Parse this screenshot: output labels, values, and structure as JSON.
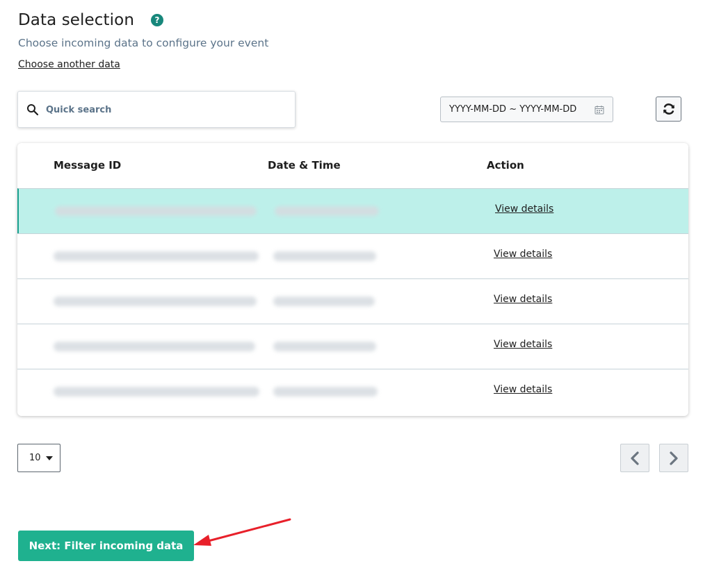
{
  "header": {
    "title": "Data selection",
    "help_glyph": "?",
    "subtitle": "Choose incoming data to configure your event",
    "choose_link": "Choose another data"
  },
  "search": {
    "placeholder": "Quick search",
    "value": ""
  },
  "date_range": {
    "value": "YYYY-MM-DD ~ YYYY-MM-DD"
  },
  "table": {
    "columns": [
      "Message ID",
      "Date & Time",
      "Action"
    ],
    "rows": [
      {
        "action": "View details",
        "selected": true
      },
      {
        "action": "View details",
        "selected": false
      },
      {
        "action": "View details",
        "selected": false
      },
      {
        "action": "View details",
        "selected": false
      },
      {
        "action": "View details",
        "selected": false
      }
    ]
  },
  "pagination": {
    "page_size": "10"
  },
  "footer": {
    "next_label": "Next: Filter incoming data"
  },
  "colors": {
    "accent": "#1fb18f",
    "selected_row": "#bdf0ea",
    "help_icon": "#17877b",
    "arrow": "#e8202a"
  },
  "icons": [
    "help-icon",
    "search-icon",
    "calendar-icon",
    "refresh-icon",
    "caret-down-icon",
    "chevron-left-icon",
    "chevron-right-icon"
  ]
}
